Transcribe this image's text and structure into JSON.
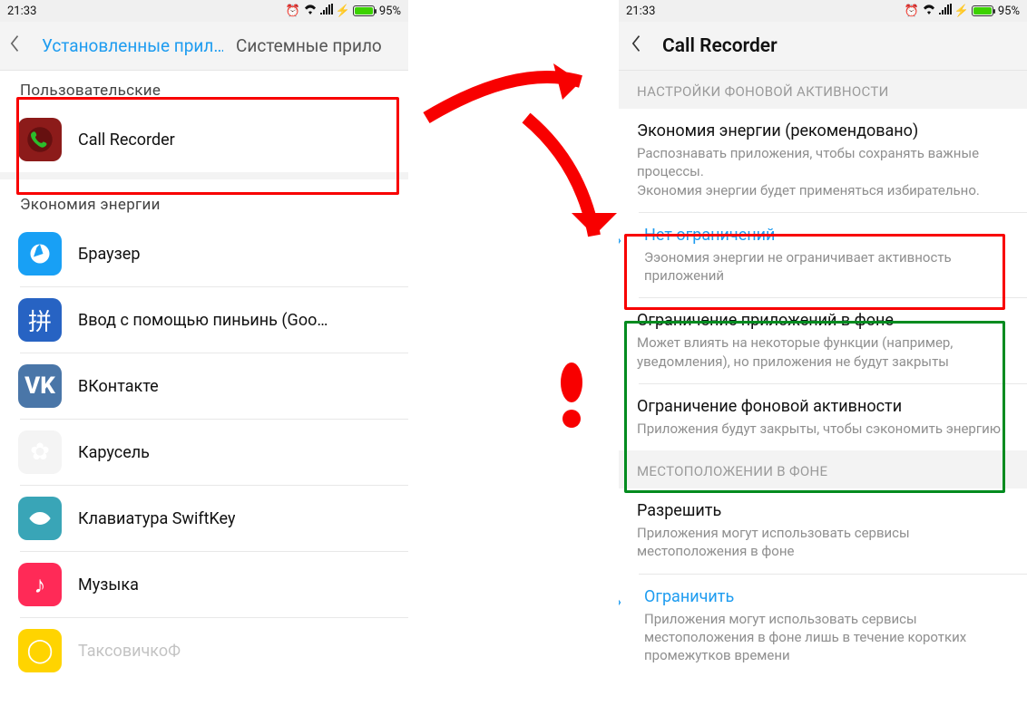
{
  "status": {
    "time": "21:33",
    "battery_pct": "95%"
  },
  "left": {
    "tabs": {
      "active": "Установленные прил…",
      "other": "Системные прило"
    },
    "sections": {
      "user_apps": "Пользовательские",
      "energy_saving": "Экономия энергии"
    },
    "user_apps": [
      {
        "name": "Call Recorder",
        "icon": "phone-icon"
      }
    ],
    "energy_apps": [
      {
        "name": "Браузер",
        "icon": "browser-icon"
      },
      {
        "name": "Ввод с помощью пиньинь (Goo…",
        "icon": "pinyin-icon"
      },
      {
        "name": "ВКонтакте",
        "icon": "vk-icon"
      },
      {
        "name": "Карусель",
        "icon": "carousel-icon"
      },
      {
        "name": "Клавиатура SwiftKey",
        "icon": "swiftkey-icon"
      },
      {
        "name": "Музыка",
        "icon": "music-icon"
      },
      {
        "name": "ТаксовичкоФ",
        "icon": "taxi-icon"
      }
    ]
  },
  "right": {
    "title": "Call Recorder",
    "sections": {
      "bg": "НАСТРОЙКИ ФОНОВОЙ АКТИВНОСТИ",
      "loc": "МЕСТОПОЛОЖЕНИИ В ФОНЕ"
    },
    "opts": {
      "eco": {
        "title": "Экономия энергии (рекомендовано)",
        "desc": "Распознавать приложения, чтобы сохранять важные процессы.\nЭкономия энергии будет применяться избирательно."
      },
      "noRestrict": {
        "title": "Нет ограничений",
        "desc": "Ээономия энергии не ограничивает активность приложений"
      },
      "bgAppLimit": {
        "title": "Ограничение приложений в фоне",
        "desc": "Может влиять на некоторые функции (например, уведомления), но приложения не будут закрыты"
      },
      "bgActLimit": {
        "title": "Ограничение фоновой активности",
        "desc": "Приложения будут закрыты, чтобы сэкономить энергию"
      },
      "locAllow": {
        "title": "Разрешить",
        "desc": "Приложения могут использовать сервисы местоположения в фоне"
      },
      "locRestrict": {
        "title": "Ограничить",
        "desc": "Приложения могут использовать сервисы местоположения в фоне лишь в течение коротких промежутков времени"
      }
    }
  }
}
